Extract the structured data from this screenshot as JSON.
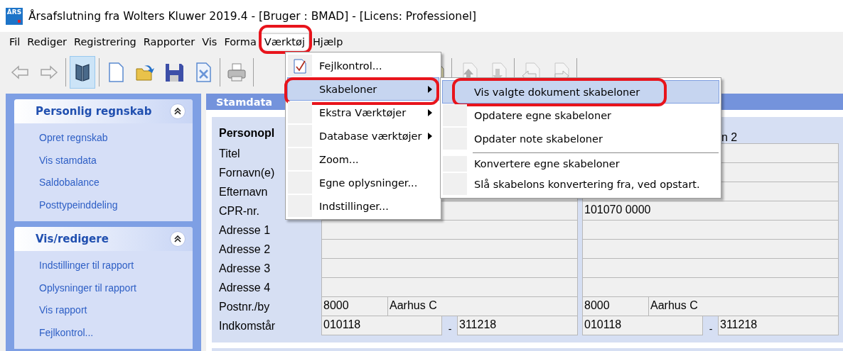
{
  "window": {
    "icon_text": "ÅRS",
    "title": "Årsafslutning fra Wolters Kluwer 2019.4 - [Bruger : BMAD] - [Licens: Professionel]"
  },
  "menubar": [
    {
      "label": "Fil",
      "open": false,
      "annotated": false
    },
    {
      "label": "Rediger",
      "open": false,
      "annotated": false
    },
    {
      "label": "Registrering",
      "open": false,
      "annotated": false
    },
    {
      "label": "Rapporter",
      "open": false,
      "annotated": false
    },
    {
      "label": "Vis",
      "open": false,
      "annotated": false
    },
    {
      "label": "Forma",
      "open": false,
      "annotated": false
    },
    {
      "label": "Værktøj",
      "open": true,
      "annotated": true
    },
    {
      "label": "Hjælp",
      "open": false,
      "annotated": false
    }
  ],
  "toolbar": [
    {
      "selected": false,
      "disabled": true
    },
    {
      "selected": false,
      "disabled": true
    },
    {
      "selected": true,
      "disabled": false
    },
    {
      "selected": false,
      "disabled": false
    },
    {
      "selected": false,
      "disabled": false
    },
    {
      "selected": false,
      "disabled": false
    },
    {
      "selected": false,
      "disabled": false
    },
    {
      "selected": false,
      "disabled": false
    },
    {
      "selected": false,
      "disabled": false
    },
    {
      "selected": false,
      "disabled": true
    },
    {
      "selected": false,
      "disabled": true
    },
    {
      "selected": false,
      "disabled": true
    },
    {
      "selected": false,
      "disabled": true
    }
  ],
  "sidebar": {
    "panels": [
      {
        "title": "Personlig regnskab",
        "expanded": true,
        "items": [
          "Opret regnskab",
          "Vis stamdata",
          "Saldobalance",
          "Posttypeinddeling"
        ]
      },
      {
        "title": "Vis/redigere",
        "expanded": true,
        "items": [
          "Indstillinger til rapport",
          "Oplysninger til rapport",
          "Vis rapport",
          "Fejlkontrol..."
        ]
      }
    ]
  },
  "stamdata": {
    "tab": "Stamdata",
    "section_title": "Personopl",
    "column_2_title": "n 2",
    "rows": [
      {
        "label": "Titel",
        "person_2": [
          {
            "kind": "text"
          }
        ]
      },
      {
        "label": "Fornavn(e)",
        "person_2": [
          {
            "kind": "text"
          }
        ]
      },
      {
        "label": "Efternavn",
        "person_1": [
          {
            "kind": "text"
          }
        ],
        "person_2": [
          {
            "kind": "text"
          }
        ]
      },
      {
        "label": "CPR-nr.",
        "person_1": [
          {
            "kind": "text"
          }
        ],
        "person_2": [
          {
            "kind": "text",
            "value": "101070 0000"
          }
        ]
      },
      {
        "label": "Adresse 1",
        "person_1": [
          {
            "kind": "text"
          }
        ],
        "person_2": [
          {
            "kind": "text"
          }
        ]
      },
      {
        "label": "Adresse 2",
        "person_1": [
          {
            "kind": "text"
          }
        ],
        "person_2": [
          {
            "kind": "text"
          }
        ]
      },
      {
        "label": "Adresse 3",
        "person_1": [
          {
            "kind": "text"
          }
        ],
        "person_2": [
          {
            "kind": "text"
          }
        ]
      },
      {
        "label": "Adresse 4",
        "person_1": [
          {
            "kind": "text"
          }
        ],
        "person_2": [
          {
            "kind": "text"
          }
        ]
      },
      {
        "label": "Postnr./by",
        "person_1": [
          {
            "kind": "short",
            "value": "8000"
          },
          {
            "kind": "text",
            "value": "Aarhus C"
          }
        ],
        "person_2": [
          {
            "kind": "short",
            "value": "8000"
          },
          {
            "kind": "text",
            "value": "Aarhus C"
          }
        ]
      },
      {
        "label": "Indkomstår",
        "person_1": [
          {
            "kind": "text",
            "value": "010118"
          },
          {
            "kind": "dash",
            "text": "-"
          },
          {
            "kind": "text",
            "value": "311218"
          }
        ],
        "person_2": [
          {
            "kind": "text",
            "value": "010118"
          },
          {
            "kind": "dash",
            "text": "-"
          },
          {
            "kind": "text",
            "value": "311218"
          }
        ]
      }
    ]
  },
  "tools_menu": {
    "items": [
      {
        "label": "Fejlkontrol...",
        "has_icon": true,
        "has_submenu": false,
        "selected": false,
        "annotated": false
      },
      {
        "label": "Skabeloner",
        "has_icon": false,
        "has_submenu": true,
        "selected": true,
        "annotated": true
      },
      {
        "label": "Ekstra Værktøjer",
        "has_icon": false,
        "has_submenu": true,
        "selected": false,
        "annotated": false
      },
      {
        "label": "Database værktøjer",
        "has_icon": false,
        "has_submenu": true,
        "selected": false,
        "annotated": false
      },
      {
        "label": "Zoom...",
        "has_icon": false,
        "has_submenu": false,
        "selected": false,
        "annotated": false
      },
      {
        "label": "Egne oplysninger...",
        "has_icon": false,
        "has_submenu": false,
        "selected": false,
        "annotated": false
      },
      {
        "label": "Indstillinger...",
        "has_icon": false,
        "has_submenu": false,
        "selected": false,
        "annotated": false
      }
    ]
  },
  "templates_submenu": {
    "items": [
      {
        "label": "Vis valgte dokument skabeloner",
        "selected": true,
        "annotated": true,
        "separator_before": false
      },
      {
        "label": "Opdatere egne skabeloner",
        "selected": false,
        "annotated": false,
        "separator_before": false
      },
      {
        "label": "Opdater note skabeloner",
        "selected": false,
        "annotated": false,
        "separator_before": false
      },
      {
        "label": "Konvertere egne skabeloner",
        "selected": false,
        "annotated": false,
        "separator_before": true
      },
      {
        "label": "Slå skabelons konvertering fra, ved opstart.",
        "selected": false,
        "annotated": false,
        "separator_before": false
      }
    ]
  }
}
